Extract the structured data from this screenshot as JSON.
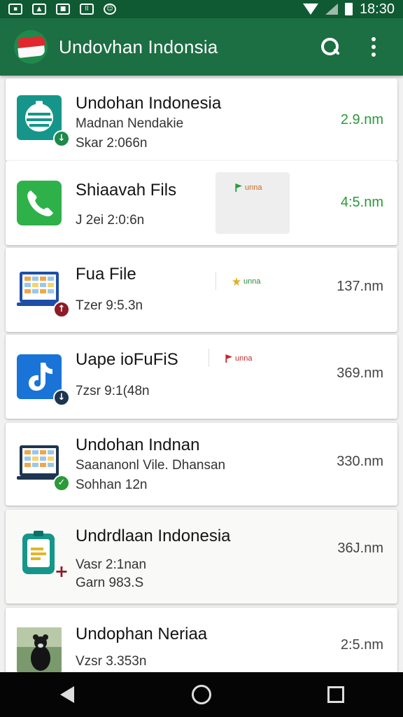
{
  "status_bar": {
    "time": "18:30",
    "icons": [
      "sim-icon",
      "image-icon",
      "phone-icon",
      "signal-icon",
      "whatsapp-icon"
    ]
  },
  "app_bar": {
    "title": "Undovhan Indonsia",
    "logo": "indonesia-flag-icon",
    "actions": [
      "search-icon",
      "more-vert-icon"
    ]
  },
  "colors": {
    "status_bar": "#0f5a33",
    "app_bar": "#1c6e43",
    "accent_green": "#2b9a37",
    "badge_red": "#8e1b27",
    "badge_navy": "#1d3550"
  },
  "files": [
    {
      "title": "Undohan Indonesia",
      "line1": "Madnan Nendakie",
      "line2": "Skar 2:066n",
      "size": "2.9.nm",
      "icon": "document-icon",
      "badge": "download-icon"
    },
    {
      "title": "Shiaavah Fils",
      "line1": "",
      "line2": "J 2ei 2:0:6n",
      "size": "4:5.nm",
      "icon": "phone-icon",
      "tag": "unna"
    },
    {
      "title": "Fua File",
      "line1": "",
      "line2": "Tzer 9:5.3n",
      "size": "137.nm",
      "icon": "spreadsheet-icon",
      "badge": "upload-icon",
      "tag": "unna"
    },
    {
      "title": "Uape ioFuFiS",
      "line1": "",
      "line2": "7zsr 9:1(48n",
      "size": "369.nm",
      "icon": "music-note-icon",
      "badge": "download-icon",
      "tag": "unna"
    },
    {
      "title": "Undohan Indnan",
      "line1": "Saananonl Vile. Dhansan",
      "line2": "Sohhan 12n",
      "size": "330.nm",
      "icon": "spreadsheet-icon",
      "badge": "check-icon"
    },
    {
      "title": "Undrdlaan Indonesia",
      "line1": "Vasr 2:1nan",
      "line2": "Garn 983.S",
      "size": "36J.nm",
      "icon": "clipboard-icon",
      "badge": "plus-icon"
    },
    {
      "title": "Undophan Neriaa",
      "line1": "",
      "line2": "Vzsr 3.353n",
      "size": "2:5.nm",
      "icon": "image-thumbnail-icon"
    }
  ],
  "nav_bar": [
    "back-icon",
    "home-icon",
    "recent-apps-icon"
  ]
}
